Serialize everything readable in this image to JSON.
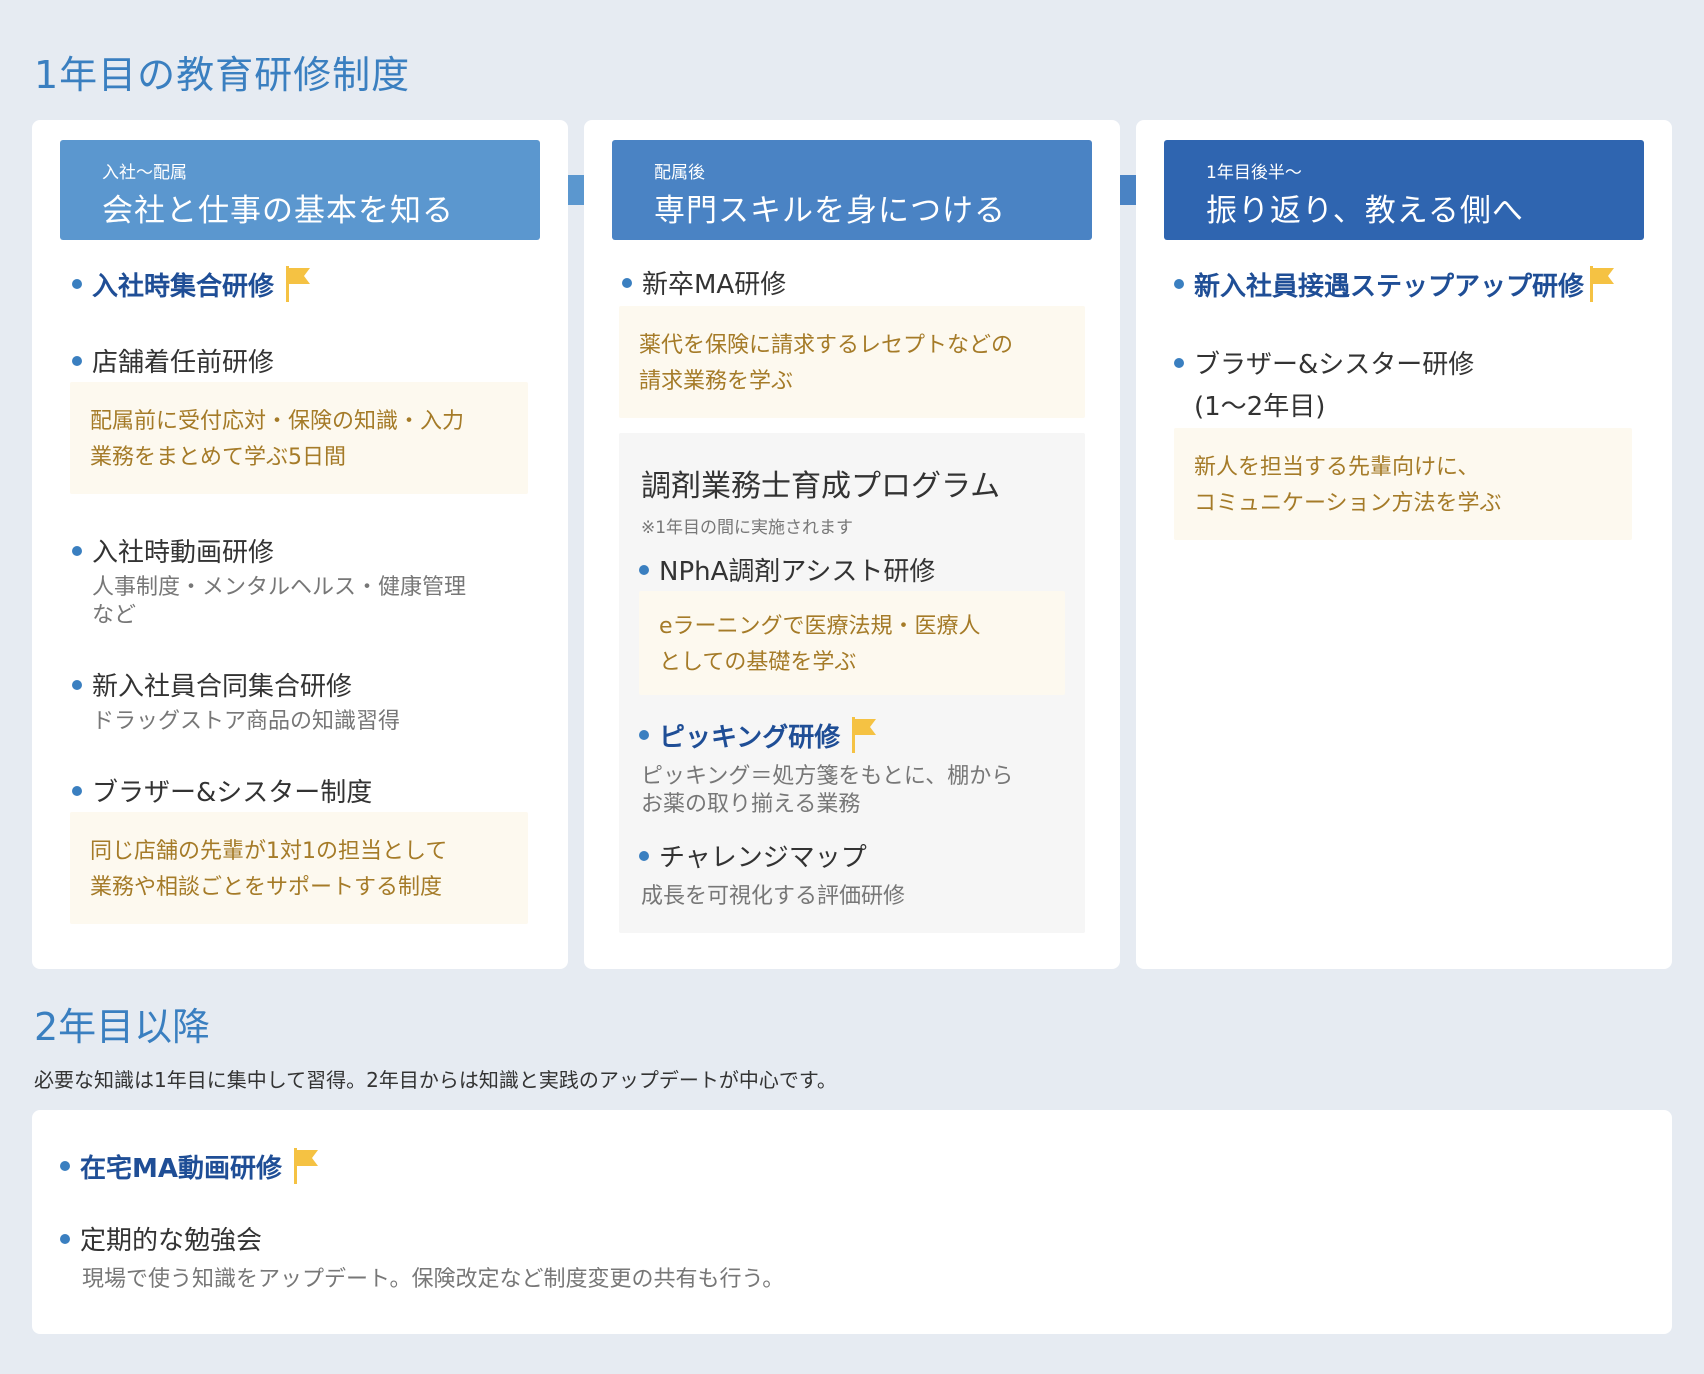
{
  "section1": {
    "title": "1年目の教育研修制度"
  },
  "col1": {
    "sub": "入社〜配属",
    "title": "会社と仕事の基本を知る",
    "items": [
      {
        "label": "入社時集合研修"
      },
      {
        "label": "店舗着任前研修",
        "note": [
          "配属前に受付応対・保険の知識・入力",
          "業務をまとめて学ぶ5日間"
        ]
      },
      {
        "label": "入社時動画研修",
        "desc": [
          "人事制度・メンタルヘルス・健康管理",
          "など"
        ]
      },
      {
        "label": "新入社員合同集合研修",
        "desc": [
          "ドラッグストア商品の知識習得"
        ]
      },
      {
        "label": "ブラザー&シスター制度",
        "note": [
          "同じ店舗の先輩が1対1の担当として",
          "業務や相談ごとをサポートする制度"
        ]
      }
    ]
  },
  "col2": {
    "sub": "配属後",
    "title": "専門スキルを身につける",
    "item1": {
      "label": "新卒MA研修",
      "note": [
        "薬代を保険に請求するレセプトなどの",
        "請求業務を学ぶ"
      ]
    },
    "program": {
      "title": "調剤業務士育成プログラム",
      "note": "※1年目の間に実施されます",
      "items": [
        {
          "label": "NPhA調剤アシスト研修",
          "note": [
            "eラーニングで医療法規・医療人",
            "としての基礎を学ぶ"
          ]
        },
        {
          "label": "ピッキング研修",
          "desc": [
            "ピッキング＝処方箋をもとに、棚から",
            "お薬の取り揃える業務"
          ]
        },
        {
          "label": "チャレンジマップ",
          "desc": [
            "成長を可視化する評価研修"
          ]
        }
      ]
    }
  },
  "col3": {
    "sub": "1年目後半〜",
    "title": "振り返り、教える側へ",
    "items": [
      {
        "label": "新入社員接遇ステップアップ研修"
      },
      {
        "label": [
          "ブラザー&シスター研修",
          "(1〜2年目)"
        ],
        "note": [
          "新人を担当する先輩向けに、",
          "コミュニケーション方法を学ぶ"
        ]
      }
    ]
  },
  "section2": {
    "title": "2年目以降",
    "intro": "必要な知識は1年目に集中して習得。2年目からは知識と実践のアップデートが中心です。",
    "items": [
      {
        "label": "在宅MA動画研修"
      },
      {
        "label": "定期的な勉強会",
        "desc": "現場で使う知識をアップデート。保険改定など制度変更の共有も行う。"
      }
    ]
  },
  "colors": {
    "accent": "#3a7fc0",
    "highlight": "#1f4e96",
    "note_bg": "#fdf9ef",
    "note_text": "#a57b28",
    "flag": "#f5c243"
  },
  "icons": {
    "bullet": "dot-icon",
    "flag": "flag-icon"
  }
}
